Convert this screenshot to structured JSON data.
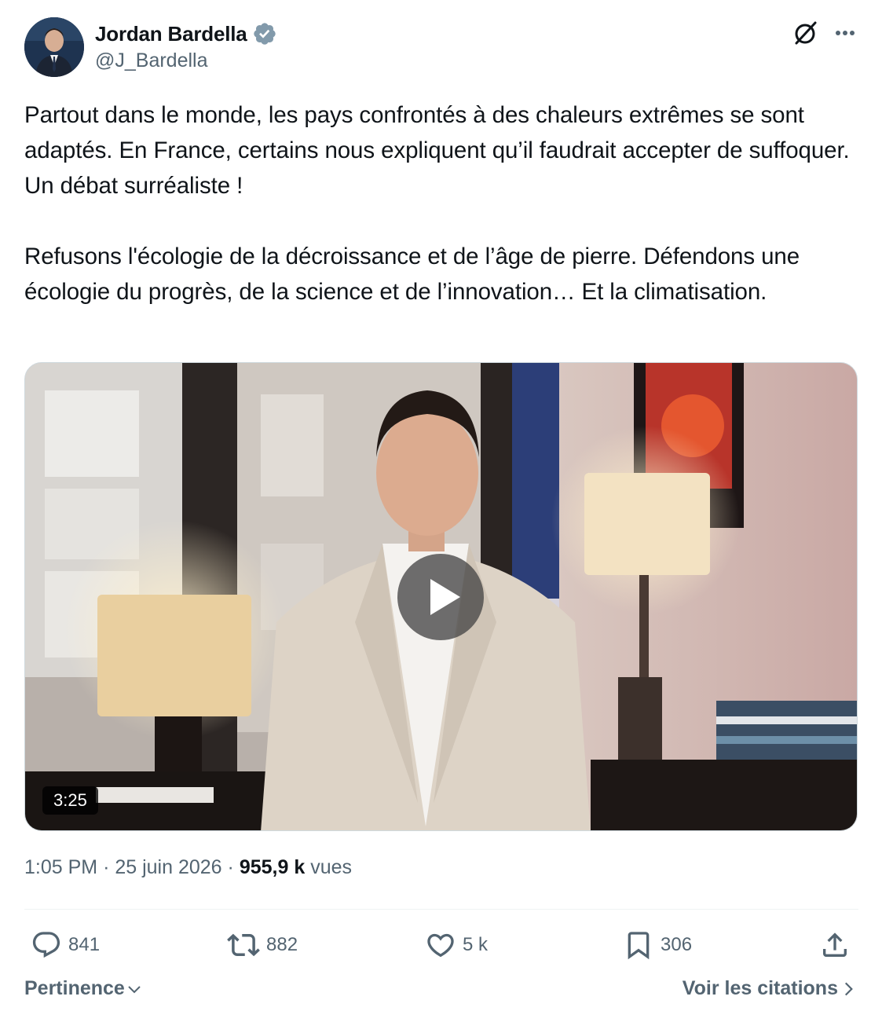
{
  "author": {
    "display_name": "Jordan Bardella",
    "handle": "@J_Bardella",
    "verified": true
  },
  "header_icons": {
    "grok": "grok-icon",
    "more": "more-icon"
  },
  "tweet": {
    "paragraphs": [
      "Partout dans le monde, les pays confrontés à des chaleurs extrêmes se sont adaptés. En France, certains nous expliquent qu’il faudrait accepter de suffoquer. Un débat surréaliste !",
      "Refusons l'écologie de la décroissance et de l’âge de pierre. Défendons une écologie du progrès, de la science et de l’innovation… Et la climatisation."
    ]
  },
  "media": {
    "type": "video",
    "duration": "3:25"
  },
  "meta": {
    "time": "1:05 PM",
    "separator": "·",
    "date": "25 juin 2026",
    "views_count": "955,9 k",
    "views_label": "vues"
  },
  "actions": {
    "replies": "841",
    "reposts": "882",
    "likes": "5 k",
    "bookmarks": "306"
  },
  "footer": {
    "sort_label": "Pertinence",
    "quotes_label": "Voir les citations"
  },
  "colors": {
    "text_primary": "#0f1419",
    "text_secondary": "#536471",
    "verified_blue": "#1d9bf0",
    "divider": "#eff3f4"
  }
}
